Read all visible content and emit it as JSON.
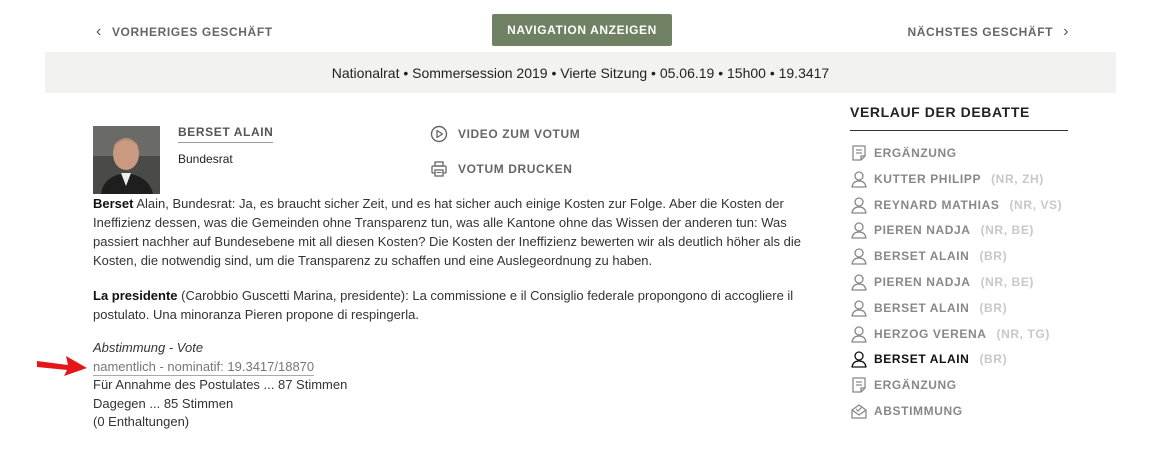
{
  "nav": {
    "prev_label": "VORHERIGES GESCHÄFT",
    "next_label": "NÄCHSTES GESCHÄFT",
    "center_button": "NAVIGATION ANZEIGEN"
  },
  "infobar": {
    "text": "Nationalrat • Sommersession 2019 • Vierte Sitzung • 05.06.19 • 15h00 • 19.3417"
  },
  "speaker": {
    "name": "BERSET ALAIN",
    "role": "Bundesrat"
  },
  "actions": {
    "video": "VIDEO ZUM VOTUM",
    "print": "VOTUM DRUCKEN"
  },
  "speech1": {
    "speaker_bold": "Berset",
    "text": " Alain, Bundesrat: Ja, es braucht sicher Zeit, und es hat sicher auch einige Kosten zur Folge. Aber die Kosten der Ineffizienz dessen, was die Gemeinden ohne Transparenz tun, was alle Kantone ohne das Wissen der anderen tun: Was passiert nachher auf Bundesebene mit all diesen Kosten? Die Kosten der Ineffizienz bewerten wir als deutlich höher als die Kosten, die notwendig sind, um die Transparenz zu schaffen und eine Auslegeordnung zu haben."
  },
  "speech2": {
    "speaker_bold": "La presidente",
    "text": " (Carobbio Guscetti Marina, presidente): La commissione e il Consiglio federale propongono di accogliere il postulato. Una minoranza Pieren propone di respingerla."
  },
  "vote": {
    "label": "Abstimmung - Vote",
    "link": "namentlich - nominatif: 19.3417/18870",
    "for": "Für Annahme des Postulates ... 87 Stimmen",
    "against": "Dagegen ... 85 Stimmen",
    "abstentions": "(0 Enthaltungen)"
  },
  "sidebar": {
    "title": "VERLAUF DER DEBATTE",
    "items": [
      {
        "icon": "document-icon",
        "label": "ERGÄNZUNG",
        "meta": ""
      },
      {
        "icon": "person-icon",
        "label": "KUTTER PHILIPP",
        "meta": "(NR, ZH)"
      },
      {
        "icon": "person-icon",
        "label": "REYNARD MATHIAS",
        "meta": "(NR, VS)"
      },
      {
        "icon": "person-icon",
        "label": "PIEREN NADJA",
        "meta": "(NR, BE)"
      },
      {
        "icon": "person-icon",
        "label": "BERSET ALAIN",
        "meta": "(BR)"
      },
      {
        "icon": "person-icon",
        "label": "PIEREN NADJA",
        "meta": "(NR, BE)"
      },
      {
        "icon": "person-icon",
        "label": "BERSET ALAIN",
        "meta": "(BR)"
      },
      {
        "icon": "person-icon",
        "label": "HERZOG VERENA",
        "meta": "(NR, TG)"
      },
      {
        "icon": "person-icon",
        "label": "BERSET ALAIN",
        "meta": "(BR)",
        "active": true
      },
      {
        "icon": "document-icon",
        "label": "ERGÄNZUNG",
        "meta": ""
      },
      {
        "icon": "ballot-icon",
        "label": "ABSTIMMUNG",
        "meta": ""
      }
    ]
  },
  "colors": {
    "nav_button": "#6f8162",
    "infobar_bg": "#f2f2f0",
    "arrow": "#e3171b"
  }
}
